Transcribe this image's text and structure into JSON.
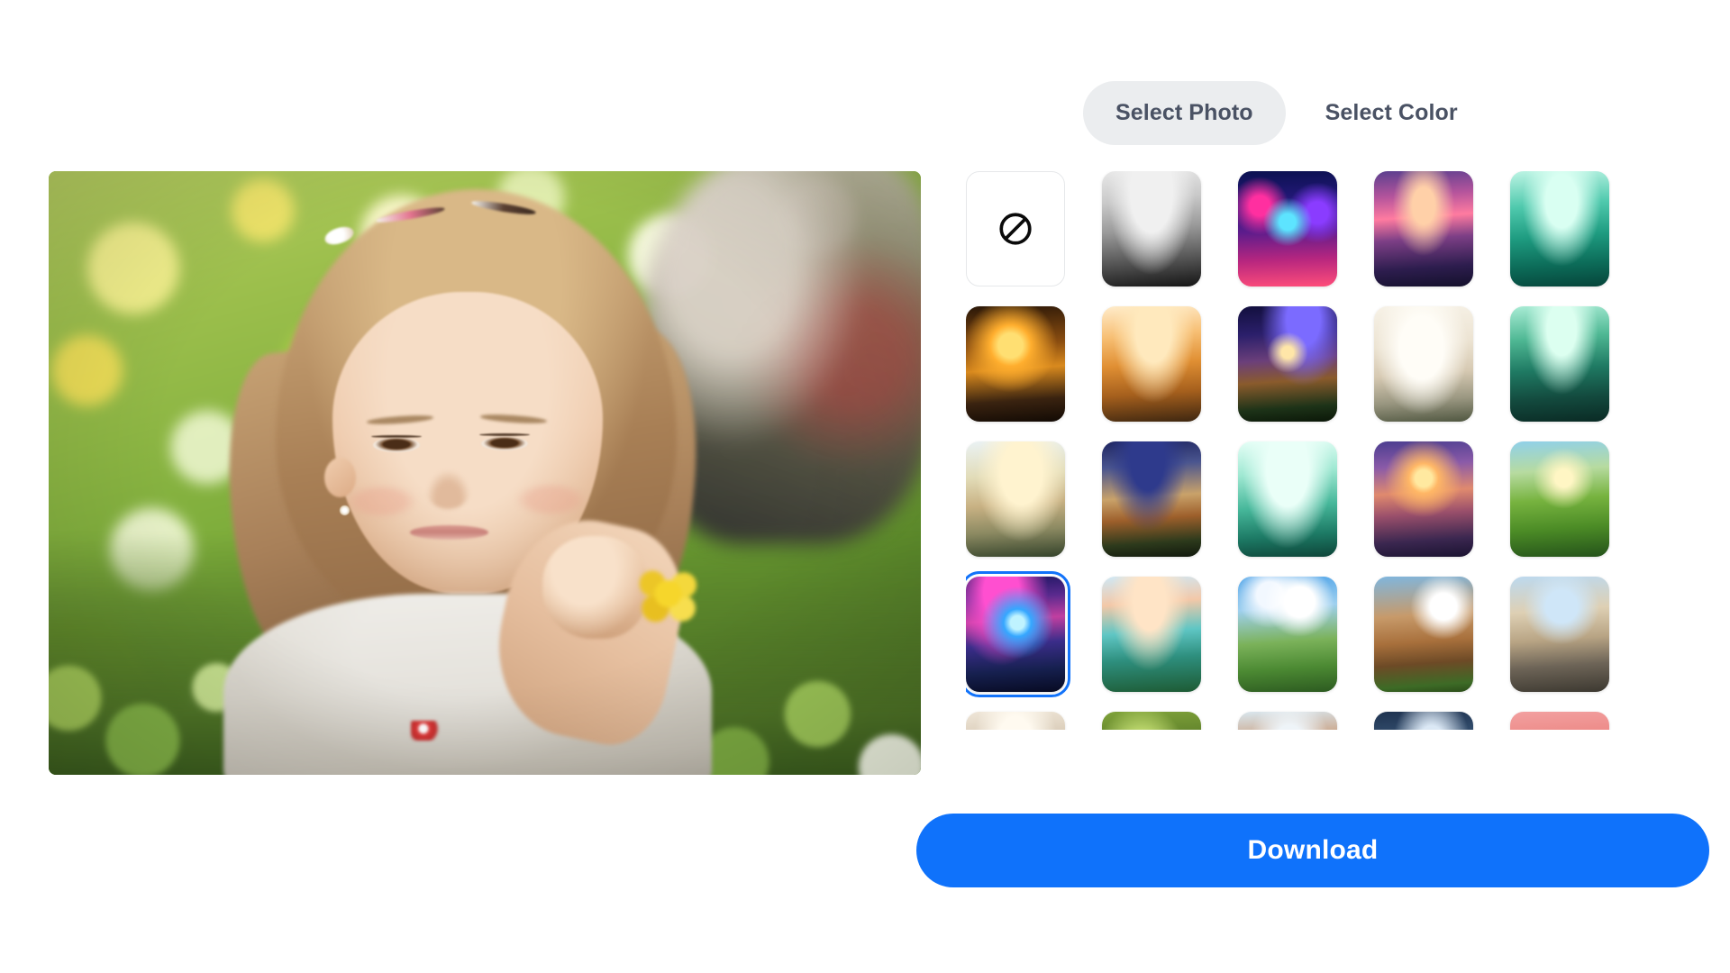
{
  "theme": {
    "accent_blue": "#0f72fb",
    "tab_active_bg": "#ebedef",
    "tab_text": "#4a5264",
    "selected_border": "#1273fa",
    "page_bg": "#ffffff"
  },
  "preview": {
    "alt": "young girl lying in a green meadow resting chin on hand with yellow and white flowers",
    "subject": "child-portrait",
    "background_scene": "blurred green and yellow bokeh meadow"
  },
  "tabs": [
    {
      "id": "select-photo",
      "label": "Select Photo",
      "active": true
    },
    {
      "id": "select-color",
      "label": "Select Color",
      "active": false
    }
  ],
  "thumbnails": [
    {
      "id": "none",
      "type": "none",
      "icon": "no-entry-icon",
      "label": "No background",
      "selected": false
    },
    {
      "id": "t01",
      "type": "photo",
      "label": "Grayscale misty mountain river",
      "selected": false,
      "style": "radial-gradient(ellipse at 50% 18%, #f0f0f0 0 30%, transparent 62%), linear-gradient(175deg,#e8e8e8 0%,#c9c9c9 26%,#9a9a9a 50%,#5a5a5a 74%,#141414 100%)"
    },
    {
      "id": "t02",
      "type": "photo",
      "label": "Neon cyberpunk city skyline",
      "selected": false,
      "style": "radial-gradient(circle at 50% 44%, #5de4ff 0 10%, transparent 30%), radial-gradient(circle at 22% 30%, #ff2fa0 0 9%, transparent 26%), radial-gradient(circle at 80% 36%, #8a3cff 0 10%, transparent 28%), linear-gradient(178deg,#0b1150 0%,#26197d 28%,#5e1c8c 52%,#b7267f 76%,#ff4d7a 100%)"
    },
    {
      "id": "t03",
      "type": "photo",
      "label": "Purple pink sunset mountain lake",
      "selected": false,
      "style": "radial-gradient(ellipse at 50% 30%, #ffd0a8 0 16%, transparent 44%), linear-gradient(176deg,#5a3f8e 0%,#b5549c 22%,#ff7ba0 40%,#7d3f86 58%,#2d1d4e 82%,#14102b 100%)"
    },
    {
      "id": "t04",
      "type": "photo",
      "label": "Teal green mountain river valley",
      "selected": false,
      "style": "radial-gradient(ellipse at 52% 26%, #d9fff2 0 22%, transparent 54%), linear-gradient(176deg,#bdf4e4 0%,#4fc9ad 30%,#1e9b80 56%,#0c6b58 80%,#06443a 100%)"
    },
    {
      "id": "t05",
      "type": "photo",
      "label": "Golden sunset winding road valley",
      "selected": false,
      "style": "radial-gradient(circle at 45% 34%, #ffdf72 0 13%, #ffae2e 22%, transparent 50%), linear-gradient(176deg,#2a1708 0%,#8a4d10 34%,#d98a1e 54%,#3a2310 80%,#120a04 100%)"
    },
    {
      "id": "t06",
      "type": "photo",
      "label": "Orange sunrise misty mountain road",
      "selected": false,
      "style": "radial-gradient(ellipse at 52% 22%, #ffe9bd 0 24%, transparent 56%), linear-gradient(176deg,#ffeccb 0%,#f7bf74 26%,#e08f33 50%,#a6601d 74%,#3d2610 100%)"
    },
    {
      "id": "t07",
      "type": "photo",
      "label": "Starry night milky way river valley",
      "selected": false,
      "style": "radial-gradient(circle at 50% 40%, #ffe6a8 0 7%, transparent 24%), radial-gradient(ellipse at 66% 12%, #7b6bff 0 18%, transparent 46%), linear-gradient(176deg,#120f3d 0%,#2b1f6b 24%,#6b3f7a 46%,#8a5b2c 64%,#1d3318 86%,#0b1708 100%)"
    },
    {
      "id": "t08",
      "type": "photo",
      "label": "Pale foggy mountain valley",
      "selected": false,
      "style": "radial-gradient(ellipse at 48% 36%, #fffdf7 0 30%, transparent 64%), linear-gradient(176deg,#f7f2e7 0%,#ece3d2 34%,#d6c9b2 58%,#9a9781 80%,#4f5640 100%)"
    },
    {
      "id": "t09",
      "type": "photo",
      "label": "Green forest viaduct bridge",
      "selected": false,
      "style": "radial-gradient(ellipse at 52% 20%, #dcfff0 0 20%, transparent 50%), linear-gradient(176deg,#a9ecd5 0%,#4fb894 28%,#1f7a63 54%,#134a3e 78%,#0a2a24 100%)"
    },
    {
      "id": "t10",
      "type": "photo",
      "label": "Hazy sunrise terraced hillside",
      "selected": false,
      "style": "radial-gradient(ellipse at 56% 28%, #fff3cf 0 26%, transparent 58%), linear-gradient(176deg,#eaf2f4 0%,#e2dcb8 30%,#c8b183 54%,#8c8a62 76%,#33422a 100%)"
    },
    {
      "id": "t11",
      "type": "photo",
      "label": "Night sky lake with cliff village",
      "selected": false,
      "style": "radial-gradient(ellipse at 46% 16%, #2e3a8c 0 22%, transparent 52%), linear-gradient(176deg,#1e2560 0%,#4a558f 22%,#c9a26a 48%,#9d5f2b 66%,#2d3a1c 86%,#11180c 100%)"
    },
    {
      "id": "t12",
      "type": "photo",
      "label": "Mint teal misty lake valley",
      "selected": false,
      "style": "radial-gradient(ellipse at 50% 24%, #eafff8 0 30%, transparent 64%), linear-gradient(176deg,#e6fff7 0%,#9fe8d2 28%,#46b79a 56%,#1d7a65 80%,#0d4438 100%)"
    },
    {
      "id": "t13",
      "type": "photo",
      "label": "Purple sunrise reflected lake",
      "selected": false,
      "style": "radial-gradient(circle at 50% 32%, #ffe9a0 0 9%, #ffb766 16%, transparent 42%), linear-gradient(176deg,#4b3d8f 0%,#8a5aa8 22%,#e08a6e 44%,#9a4f6b 62%,#3b2750 84%,#1a1230 100%)"
    },
    {
      "id": "t14",
      "type": "photo",
      "label": "Green vineyard hills at sunrise",
      "selected": false,
      "style": "radial-gradient(circle at 54% 32%, #fff6c4 0 9%, transparent 32%), linear-gradient(176deg,#8fd0ea 0%,#b7dba0 26%,#77b33f 50%,#4c8c26 74%,#24521a 100%)"
    },
    {
      "id": "t15",
      "type": "photo",
      "label": "Aurora neon glowing river",
      "selected": true,
      "style": "radial-gradient(circle at 52% 40%, #bff3ff 0 8%, #35a7ff 16%, transparent 42%), radial-gradient(ellipse at 36% 14%, #ff4fd0 0 20%, transparent 52%), linear-gradient(176deg,#1a1560 0%,#5a2a8e 20%,#c13fa0 38%,#3b2d8a 58%,#16204f 80%,#070a22 100%)"
    },
    {
      "id": "t16",
      "type": "photo",
      "label": "Turquoise alpine lake sunrise",
      "selected": false,
      "style": "radial-gradient(ellipse at 48% 22%, #ffe4c6 0 22%, transparent 54%), linear-gradient(176deg,#cfe8f5 0%,#f3c8a8 24%,#5fc6c4 48%,#2e8f7e 70%,#1d5a33 100%)"
    },
    {
      "id": "t17",
      "type": "photo",
      "label": "Anime temple on green hill with clouds",
      "selected": false,
      "style": "radial-gradient(circle at 62% 22%, #ffffff 0 14%, transparent 32%), radial-gradient(circle at 32% 16%, #f2f8ff 0 11%, transparent 28%), linear-gradient(176deg,#4ea3e8 0%,#9fd0ef 28%,#7bb25a 56%,#4c8a33 78%,#2c5a20 100%)"
    },
    {
      "id": "t18",
      "type": "photo",
      "label": "Ornate sandstone palace at sunset",
      "selected": false,
      "style": "radial-gradient(circle at 70% 26%, #ffffff 0 12%, transparent 30%), linear-gradient(176deg,#7fb6de 0%,#c79a6a 34%,#a8703c 56%,#6d4a26 74%,#3d6b26 92%,#2b4c19 100%)"
    },
    {
      "id": "t19",
      "type": "photo",
      "label": "Stone path between blossom hedges",
      "selected": false,
      "style": "radial-gradient(circle at 52% 26%, #cfe6f8 0 16%, transparent 38%), linear-gradient(176deg,#bcd9ef 0%,#ded0b4 30%,#b8a484 54%,#6d6457 76%,#3c3830 100%)"
    },
    {
      "id": "t20",
      "type": "photo",
      "label": "Bright interior corridor",
      "selected": false,
      "style": "radial-gradient(ellipse at 50% 30%, #fffaf0 0 26%, transparent 60%), linear-gradient(176deg,#efe6d8 0%,#cdbda6 36%,#9b8a74 64%,#5d5244 100%)"
    },
    {
      "id": "t21",
      "type": "photo",
      "label": "Dark green leaves with water drops",
      "selected": false,
      "style": "radial-gradient(ellipse at 40% 40%, #cfe87a 0 22%, transparent 54%), linear-gradient(176deg,#7fa23a 0%,#4e6f22 40%,#1f2c0f 80%,#0c1206 100%)"
    },
    {
      "id": "t22",
      "type": "photo",
      "label": "Autumn reeds against bright sky",
      "selected": false,
      "style": "radial-gradient(ellipse at 52% 34%, #eef4f8 0 24%, transparent 56%), linear-gradient(176deg,#d9e7ef 0%,#c4875a 34%,#8c4f2c 64%,#4a2a17 100%)"
    },
    {
      "id": "t23",
      "type": "photo",
      "label": "Misty blue forest at dusk",
      "selected": false,
      "style": "radial-gradient(ellipse at 58% 30%, #dbe8f5 0 18%, transparent 48%), linear-gradient(176deg,#1f3350 0%,#3c5a7c 32%,#6d4a3a 62%,#1a1a22 100%)"
    },
    {
      "id": "t24",
      "type": "photo",
      "label": "Pink gradient with white sphere",
      "selected": false,
      "style": "radial-gradient(circle at 74% 52%, #f3f7fa 0 20%, transparent 44%), linear-gradient(176deg,#f2a0a0 0%,#e8756f 44%,#d45a52 74%,#b94440 100%)"
    }
  ],
  "download": {
    "label": "Download"
  }
}
